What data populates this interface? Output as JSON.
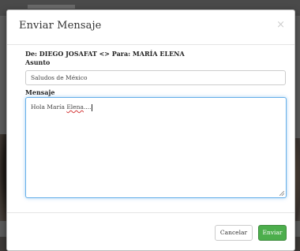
{
  "modal": {
    "title": "Enviar Mensaje",
    "close_glyph": "×",
    "route": "De: DIEGO JOSAFAT <> Para: MARÍA ELENA",
    "subject_label": "Asunto",
    "subject_value": "Saludos de México",
    "message_label": "Mensaje",
    "message_prefix": "Hola María ",
    "message_misspelled": "Elena",
    "message_suffix": "....",
    "cancel_label": "Cancelar",
    "send_label": "Enviar"
  },
  "colors": {
    "send_button": "#4cae4c",
    "focus_border": "#66afe9",
    "overlay": "#5e5e5e"
  }
}
